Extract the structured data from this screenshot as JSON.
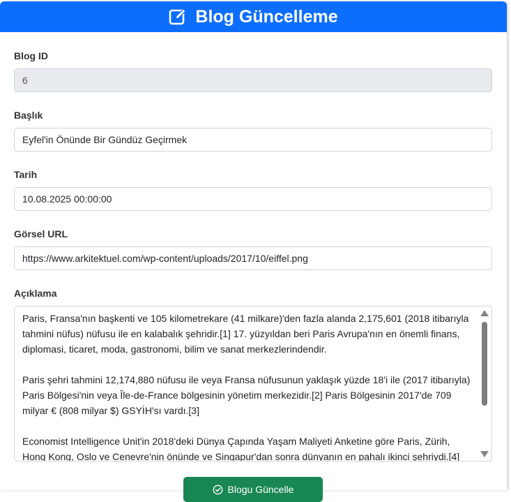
{
  "header": {
    "title": "Blog Güncelleme",
    "icon": "edit-icon"
  },
  "form": {
    "blog_id": {
      "label": "Blog ID",
      "value": "6"
    },
    "title": {
      "label": "Başlık",
      "value": "Eyfel'in Önünde Bir Gündüz Geçirmek"
    },
    "date": {
      "label": "Tarih",
      "value": "10.08.2025 00:00:00"
    },
    "image_url": {
      "label": "Görsel URL",
      "value": "https://www.arkitektuel.com/wp-content/uploads/2017/10/eiffel.png"
    },
    "description": {
      "label": "Açıklama",
      "paragraphs": [
        "Paris, Fransa'nın başkenti ve 105 kilometrekare (41 milkare)'den fazla alanda 2,175,601 (2018 itibarıyla tahmini nüfus) nüfusu ile en kalabalık şehridir.[1] 17. yüzyıldan beri Paris Avrupa'nın en önemli finans, diplomasi, ticaret, moda, gastronomi, bilim ve sanat merkezlerindendir.",
        "Paris şehri tahmini 12,174,880 nüfusu ile veya Fransa nüfusunun yaklaşık yüzde 18'i ile (2017 itibarıyla) Paris Bölgesi'nin veya Île-de-France bölgesinin yönetim merkezidir.[2] Paris Bölgesinin 2017'de 709 milyar € (808 milyar $) GSYİH'sı vardı.[3]",
        "Economist Intelligence Unit'in 2018'deki Dünya Çapında Yaşam Maliyeti Anketine göre Paris, Zürih, Hong Kong, Oslo ve Cenevre'nin önünde ve Singapur'dan sonra dünyanın en pahalı ikinci şehriydi.[4]"
      ]
    }
  },
  "submit": {
    "label": "Blogu Güncelle",
    "icon": "check-circle-icon"
  },
  "colors": {
    "header_bg": "#0d6efd",
    "button_bg": "#198754",
    "readonly_bg": "#e9ecef"
  }
}
